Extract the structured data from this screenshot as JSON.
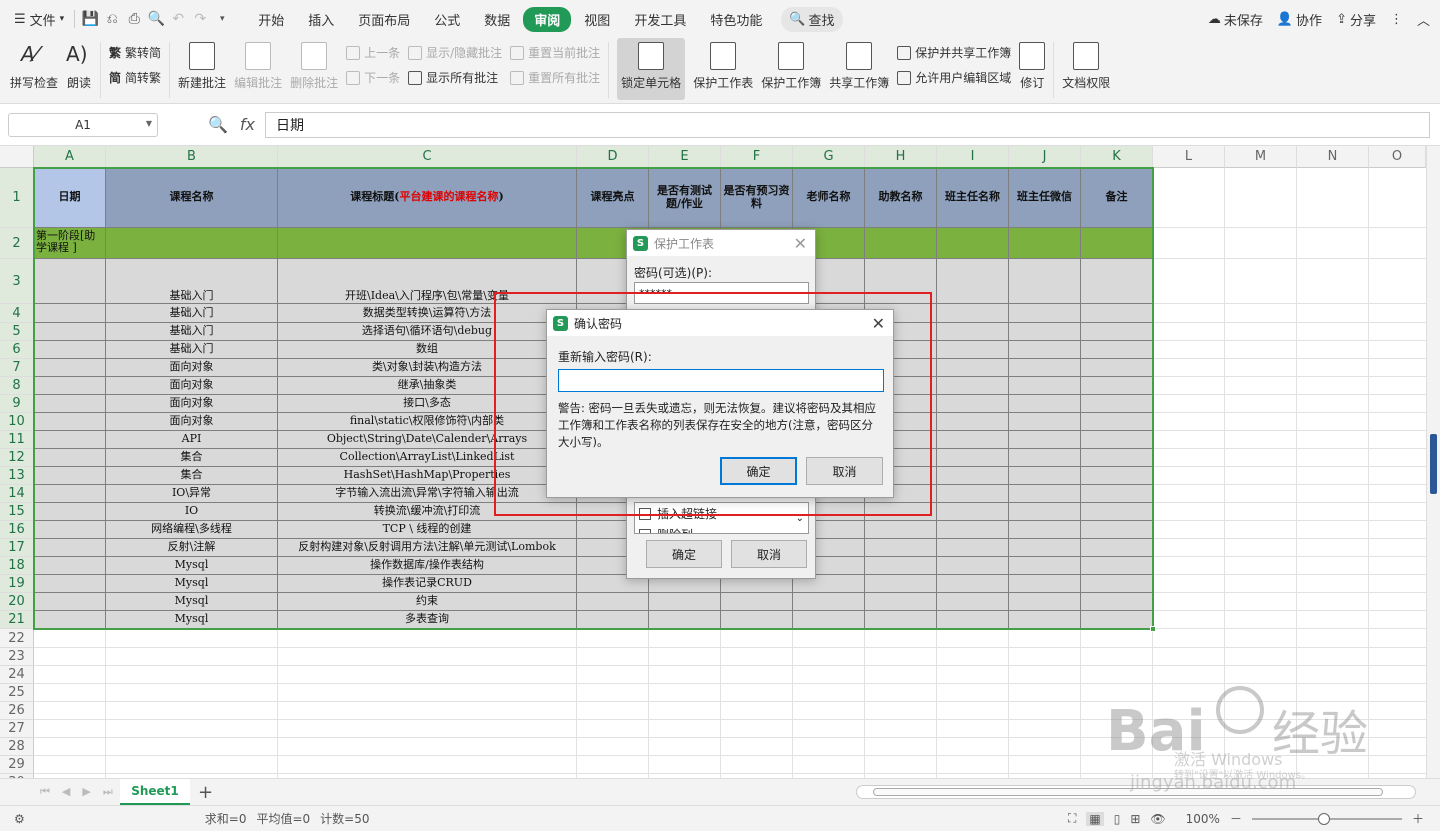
{
  "toolbar": {
    "file_label": "文件",
    "tabs": [
      "开始",
      "插入",
      "页面布局",
      "公式",
      "数据",
      "审阅",
      "视图",
      "开发工具",
      "特色功能"
    ],
    "active_tab": "审阅",
    "find_label": "查找",
    "unsaved_label": "未保存",
    "collab_label": "协作",
    "share_label": "分享"
  },
  "ribbon": {
    "spell_check": "拼写检查",
    "read_aloud": "朗读",
    "trad_to_simp": "繁转简",
    "simp_to_trad": "简转繁",
    "new_comment": "新建批注",
    "edit_comment": "编辑批注",
    "delete_comment": "删除批注",
    "prev": "上一条",
    "next": "下一条",
    "show_hide_comment": "显示/隐藏批注",
    "show_all_comments": "显示所有批注",
    "reset_current_comment": "重置当前批注",
    "reset_all_comments": "重置所有批注",
    "lock_cell": "锁定单元格",
    "protect_sheet": "保护工作表",
    "protect_workbook": "保护工作簿",
    "share_workbook": "共享工作簿",
    "protect_share_workbook": "保护并共享工作簿",
    "allow_edit_ranges": "允许用户编辑区域",
    "track_changes": "修订",
    "doc_permissions": "文档权限"
  },
  "formula_bar": {
    "cell_ref": "A1",
    "fx_label": "fx",
    "content": "日期"
  },
  "columns": [
    "A",
    "B",
    "C",
    "D",
    "E",
    "F",
    "G",
    "H",
    "I",
    "J",
    "K",
    "L",
    "M",
    "N",
    "O"
  ],
  "header_row": {
    "a": "日期",
    "b": "课程名称",
    "c_prefix": "课程标题(",
    "c_red": "平台建课的课程名称",
    "c_suffix": ")",
    "d": "课程亮点",
    "e": "是否有测试题/作业",
    "f": "是否有预习资料",
    "g": "老师名称",
    "h": "助教名称",
    "i": "班主任名称",
    "j": "班主任微信",
    "k": "备注"
  },
  "stage_label": "第一阶段[助学课程 ]",
  "rows": [
    {
      "num": "3",
      "b": "基础入门",
      "c": "开班\\Idea\\入门程序\\包\\常量\\变量"
    },
    {
      "num": "4",
      "b": "基础入门",
      "c": "数据类型转换\\运算符\\方法"
    },
    {
      "num": "5",
      "b": "基础入门",
      "c": "选择语句\\循环语句\\debug"
    },
    {
      "num": "6",
      "b": "基础入门",
      "c": "数组"
    },
    {
      "num": "7",
      "b": "面向对象",
      "c": "类\\对象\\封装\\构造方法"
    },
    {
      "num": "8",
      "b": "面向对象",
      "c": "继承\\抽象类"
    },
    {
      "num": "9",
      "b": "面向对象",
      "c": "接口\\多态"
    },
    {
      "num": "10",
      "b": "面向对象",
      "c": "final\\static\\权限修饰符\\内部类"
    },
    {
      "num": "11",
      "b": "API",
      "c": "Object\\String\\Date\\Calender\\Arrays"
    },
    {
      "num": "12",
      "b": "集合",
      "c": "Collection\\ArrayList\\LinkedList"
    },
    {
      "num": "13",
      "b": "集合",
      "c": "HashSet\\HashMap\\Properties"
    },
    {
      "num": "14",
      "b": "IO\\异常",
      "c": "字节输入流出流\\异常\\字符输入输出流"
    },
    {
      "num": "15",
      "b": "IO",
      "c": "转换流\\缓冲流\\打印流"
    },
    {
      "num": "16",
      "b": "网络编程\\多线程",
      "c": "TCP \\ 线程的创建"
    },
    {
      "num": "17",
      "b": "反射\\注解",
      "c": "反射构建对象\\反射调用方法\\注解\\单元测试\\Lombok"
    },
    {
      "num": "18",
      "b": "Mysql",
      "c": "操作数据库/操作表结构"
    },
    {
      "num": "19",
      "b": "Mysql",
      "c": "操作表记录CRUD"
    },
    {
      "num": "20",
      "b": "Mysql",
      "c": "约束"
    },
    {
      "num": "21",
      "b": "Mysql",
      "c": "多表查询"
    }
  ],
  "empty_rows": [
    "22",
    "23",
    "24",
    "25",
    "26",
    "27",
    "28",
    "29",
    "30"
  ],
  "protect_dialog": {
    "title": "保护工作表",
    "password_label": "密码(可选)(P):",
    "password_value": "******",
    "option_insert_link": "插入超链接",
    "option_delete_col": "删除列",
    "ok": "确定",
    "cancel": "取消"
  },
  "confirm_dialog": {
    "title": "确认密码",
    "reenter_label": "重新输入密码(R):",
    "input_value": "",
    "warning": "警告: 密码一旦丢失或遗忘，则无法恢复。建议将密码及其相应工作簿和工作表名称的列表保存在安全的地方(注意，密码区分大小写)。",
    "ok": "确定",
    "cancel": "取消"
  },
  "sheet_tabs": [
    "Sheet1"
  ],
  "status": {
    "sum": "求和=0",
    "avg": "平均值=0",
    "count": "计数=50",
    "zoom": "100%"
  },
  "watermark": {
    "activate": "激活 Windows",
    "goto": "转到\"设置\"以激活 Windows。",
    "site": "jingyan.baidu.com"
  }
}
